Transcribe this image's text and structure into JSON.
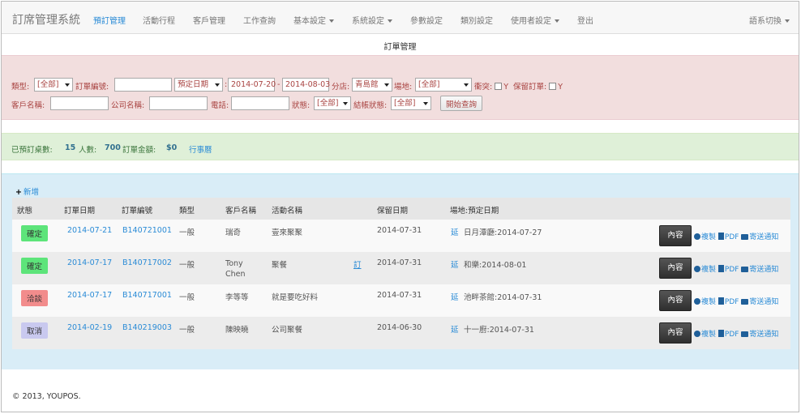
{
  "app_title": "訂席管理系統",
  "nav": {
    "items": [
      "預訂管理",
      "活動行程",
      "客戶管理",
      "工作查詢",
      "基本設定",
      "系統設定",
      "參數設定",
      "類別設定",
      "使用者設定",
      "登出"
    ],
    "lang": "語系切換"
  },
  "page_title": "訂單管理",
  "filter": {
    "type_label": "類型:",
    "type_value": "[全部]",
    "order_no_label": "訂單編號:",
    "order_no_value": "",
    "date_type_value": "預定日期",
    "date_from": "2014-07-20",
    "date_sep": "-",
    "date_to": "2014-08-03",
    "branch_label": "分店:",
    "branch_value": "青島館",
    "venue_label": "場地:",
    "venue_value": "[全部]",
    "conflict_label": "衝突:",
    "conflict_y": "Y",
    "reserve_label": "保留訂單:",
    "reserve_y": "Y",
    "customer_label": "客戶名稱:",
    "company_label": "公司名稱:",
    "phone_label": "電話:",
    "status_label": "狀態:",
    "status_value": "[全部]",
    "close_label": "結帳狀態:",
    "close_value": "[全部]",
    "query_button": "開始查詢"
  },
  "summary": {
    "tables_label": "已預訂桌數:",
    "tables_value": "15",
    "people_label": "人數:",
    "people_value": "700",
    "amount_label": "訂單金額:",
    "amount_value": "$0",
    "calendar_link": "行事曆"
  },
  "list": {
    "add_label": "新增",
    "columns": [
      "狀態",
      "訂單日期",
      "訂單編號",
      "類型",
      "客戶名稱",
      "活動名稱",
      "保留日期",
      "場地:預定日期"
    ],
    "detail_button": "內容",
    "action_copy": "複製",
    "action_pdf": "PDF",
    "action_mail": "寄送通知",
    "rows": [
      {
        "status": "確定",
        "date": "2014-07-21",
        "order_no": "B140721001",
        "type": "一般",
        "customer": "瑞奇",
        "event": "壹來聚聚",
        "flag": "",
        "hold_date": "2014-07-31",
        "venue_tag": "延",
        "venue": "日月潭廳:2014-07-27"
      },
      {
        "status": "確定",
        "date": "2014-07-17",
        "order_no": "B140717002",
        "type": "一般",
        "customer": "Tony Chen",
        "event": "聚餐",
        "flag": "訂",
        "hold_date": "2014-07-31",
        "venue_tag": "延",
        "venue": "和樂:2014-08-01"
      },
      {
        "status": "洽談",
        "date": "2014-07-17",
        "order_no": "B140717001",
        "type": "一般",
        "customer": "李等等",
        "event": "就是要吃好料",
        "flag": "",
        "hold_date": "2014-07-31",
        "venue_tag": "延",
        "venue": "池畔茶館:2014-07-31"
      },
      {
        "status": "取消",
        "date": "2014-02-19",
        "order_no": "B140219003",
        "type": "一般",
        "customer": "陳映曉",
        "event": "公司聚餐",
        "flag": "",
        "hold_date": "2014-06-30",
        "venue_tag": "延",
        "venue": "十一廚:2014-07-31"
      }
    ]
  },
  "footer": "© 2013, YOUPOS.",
  "colors": {
    "accent": "#2a8bd6",
    "filter_bg": "#f2dede",
    "summary_bg": "#dff0d8",
    "list_bg": "#d9edf7",
    "confirmed": "#5de47a",
    "negotiating": "#f28c8c",
    "cancelled": "#c9c9ef"
  }
}
